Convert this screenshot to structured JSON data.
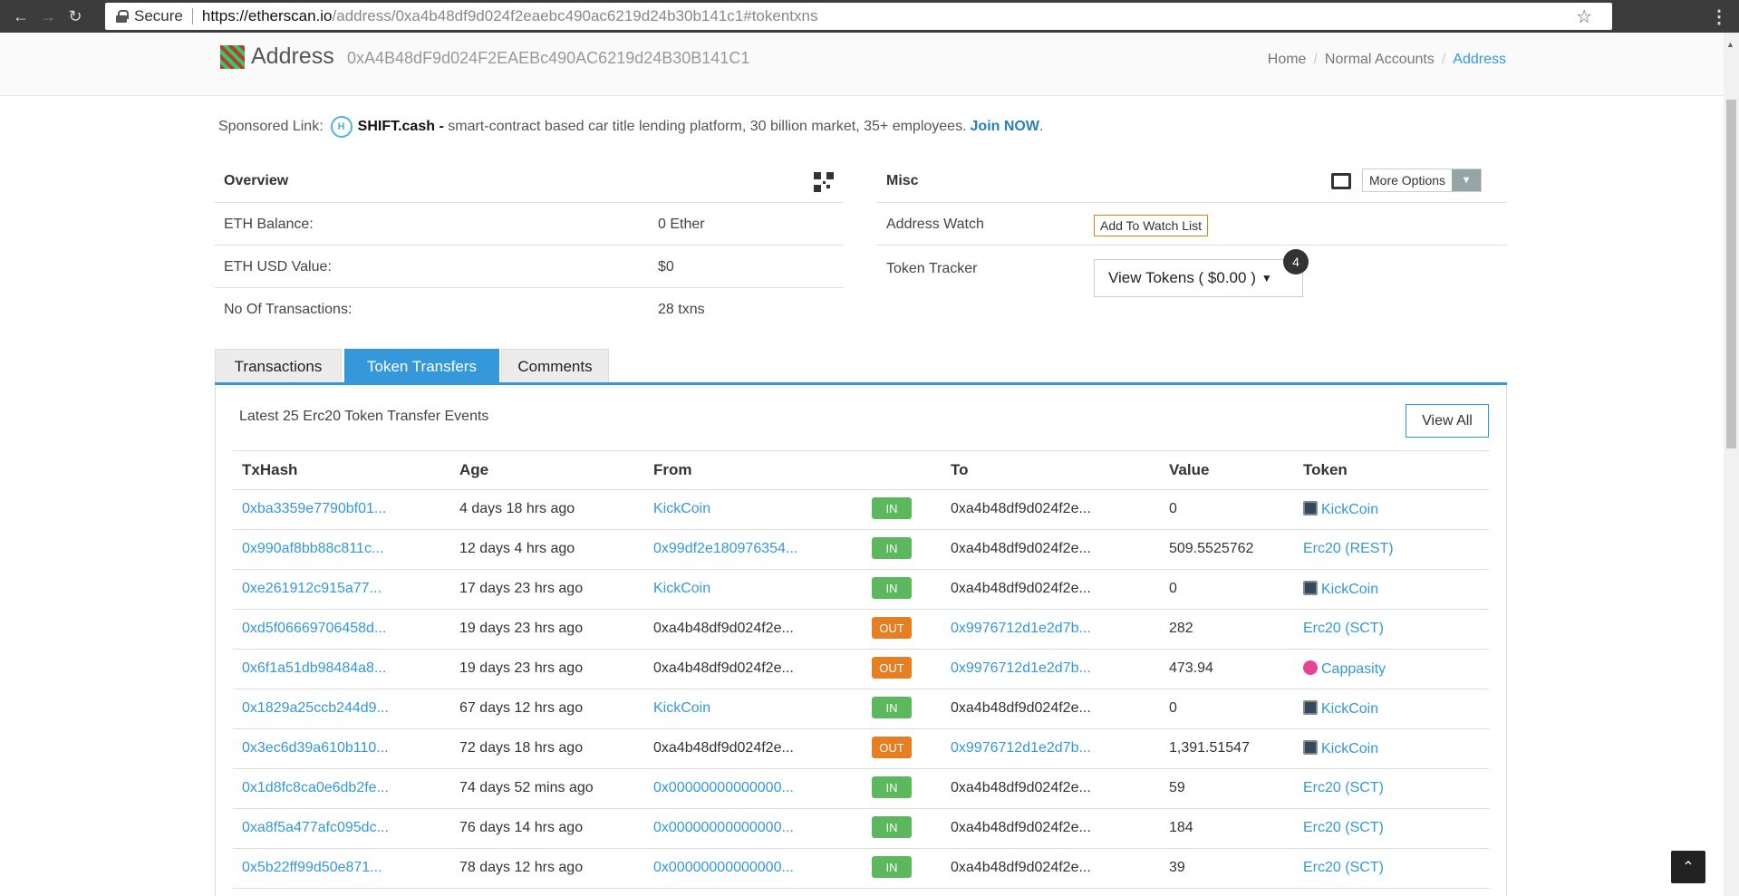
{
  "browser": {
    "secure_label": "Secure",
    "url_host": "https://etherscan.io",
    "url_rest": "/address/0xa4b48df9d024f2eaebc490ac6219d24b30b141c1#tokentxns"
  },
  "header": {
    "title": "Address",
    "hash": "0xA4B48dF9d024F2EAEBc490AC6219d24B30B141C1",
    "breadcrumb": [
      "Home",
      "Normal Accounts",
      "Address"
    ]
  },
  "sponsored": {
    "label": "Sponsored Link:",
    "brand": "SHIFT.cash -",
    "text": "smart-contract based car title lending platform, 30 billion market, 35+ employees.",
    "cta": "Join NOW",
    "cta_suffix": "."
  },
  "overview": {
    "title": "Overview",
    "rows": [
      {
        "label": "ETH Balance:",
        "value": "0 Ether"
      },
      {
        "label": "ETH USD Value:",
        "value": "$0"
      },
      {
        "label": "No Of Transactions:",
        "value": "28 txns"
      }
    ]
  },
  "misc": {
    "title": "Misc",
    "more_options": "More Options",
    "watch_label": "Address Watch",
    "watch_button": "Add To Watch List",
    "tracker_label": "Token Tracker",
    "tokens_button": "View Tokens ( $0.00 )",
    "tokens_count": "4"
  },
  "tabs": [
    "Transactions",
    "Token Transfers",
    "Comments"
  ],
  "transfers": {
    "heading": "Latest 25 Erc20 Token Transfer Events",
    "view_all": "View All",
    "columns": [
      "TxHash",
      "Age",
      "From",
      "To",
      "Value",
      "Token"
    ],
    "rows": [
      {
        "hash": "0xba3359e7790bf01...",
        "age": "4 days 18 hrs ago",
        "from": "KickCoin",
        "from_link": true,
        "dir": "IN",
        "to": "0xa4b48df9d024f2e...",
        "to_link": false,
        "value": "0",
        "token": "KickCoin",
        "token_icon": "kickcoin"
      },
      {
        "hash": "0x990af8bb88c811c...",
        "age": "12 days 4 hrs ago",
        "from": "0x99df2e180976354...",
        "from_link": true,
        "dir": "IN",
        "to": "0xa4b48df9d024f2e...",
        "to_link": false,
        "value": "509.5525762",
        "token": "Erc20 (REST)",
        "token_icon": ""
      },
      {
        "hash": "0xe261912c915a77...",
        "age": "17 days 23 hrs ago",
        "from": "KickCoin",
        "from_link": true,
        "dir": "IN",
        "to": "0xa4b48df9d024f2e...",
        "to_link": false,
        "value": "0",
        "token": "KickCoin",
        "token_icon": "kickcoin"
      },
      {
        "hash": "0xd5f06669706458d...",
        "age": "19 days 23 hrs ago",
        "from": "0xa4b48df9d024f2e...",
        "from_link": false,
        "dir": "OUT",
        "to": "0x9976712d1e2d7b...",
        "to_link": true,
        "value": "282",
        "token": "Erc20 (SCT)",
        "token_icon": ""
      },
      {
        "hash": "0x6f1a51db98484a8...",
        "age": "19 days 23 hrs ago",
        "from": "0xa4b48df9d024f2e...",
        "from_link": false,
        "dir": "OUT",
        "to": "0x9976712d1e2d7b...",
        "to_link": true,
        "value": "473.94",
        "token": "Cappasity",
        "token_icon": "cappasity"
      },
      {
        "hash": "0x1829a25ccb244d9...",
        "age": "67 days 12 hrs ago",
        "from": "KickCoin",
        "from_link": true,
        "dir": "IN",
        "to": "0xa4b48df9d024f2e...",
        "to_link": false,
        "value": "0",
        "token": "KickCoin",
        "token_icon": "kickcoin"
      },
      {
        "hash": "0x3ec6d39a610b110...",
        "age": "72 days 18 hrs ago",
        "from": "0xa4b48df9d024f2e...",
        "from_link": false,
        "dir": "OUT",
        "to": "0x9976712d1e2d7b...",
        "to_link": true,
        "value": "1,391.51547",
        "token": "KickCoin",
        "token_icon": "kickcoin"
      },
      {
        "hash": "0x1d8fc8ca0e6db2fe...",
        "age": "74 days 52 mins ago",
        "from": "0x00000000000000...",
        "from_link": true,
        "dir": "IN",
        "to": "0xa4b48df9d024f2e...",
        "to_link": false,
        "value": "59",
        "token": "Erc20 (SCT)",
        "token_icon": ""
      },
      {
        "hash": "0xa8f5a477afc095dc...",
        "age": "76 days 14 hrs ago",
        "from": "0x00000000000000...",
        "from_link": true,
        "dir": "IN",
        "to": "0xa4b48df9d024f2e...",
        "to_link": false,
        "value": "184",
        "token": "Erc20 (SCT)",
        "token_icon": ""
      },
      {
        "hash": "0x5b22ff99d50e871...",
        "age": "78 days 12 hrs ago",
        "from": "0x00000000000000...",
        "from_link": true,
        "dir": "IN",
        "to": "0xa4b48df9d024f2e...",
        "to_link": false,
        "value": "39",
        "token": "Erc20 (SCT)",
        "token_icon": ""
      }
    ]
  },
  "icons": {
    "back": "back-arrow-icon",
    "forward": "forward-arrow-icon",
    "reload": "reload-icon",
    "bookmark": "star-icon",
    "scroll_top": "chevron-up-icon"
  }
}
